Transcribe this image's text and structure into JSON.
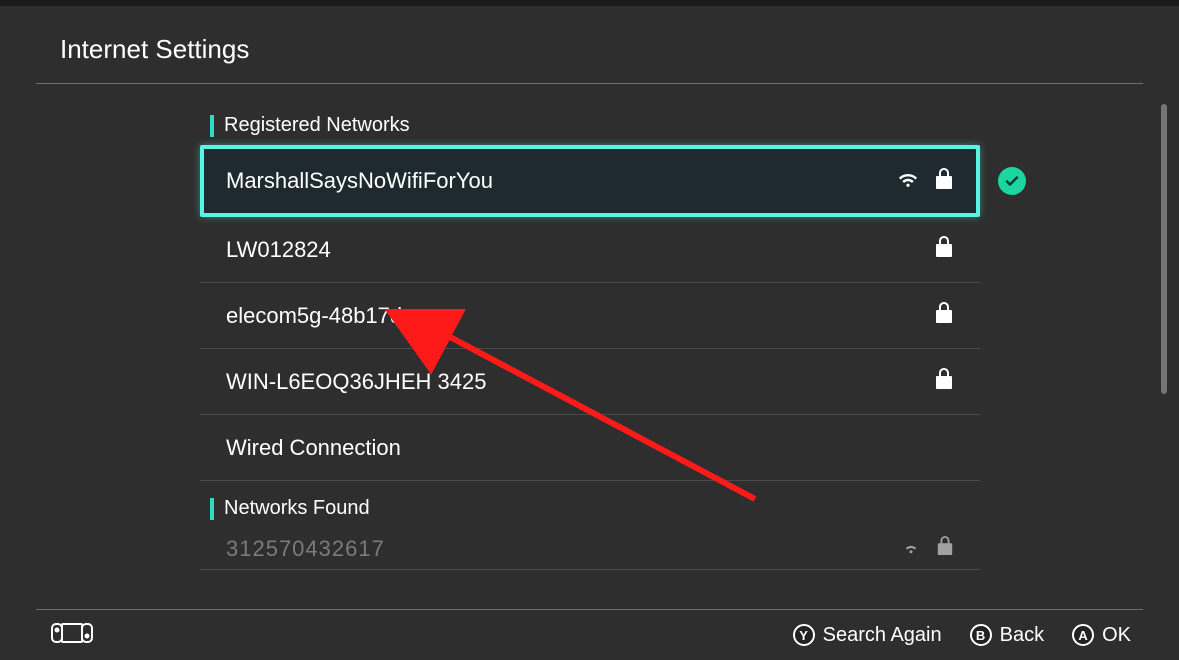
{
  "header": {
    "title": "Internet Settings"
  },
  "sections": {
    "registered": {
      "title": "Registered Networks",
      "items": [
        {
          "ssid": "MarshallSaysNoWifiForYou",
          "wifi": true,
          "locked": true,
          "selected": true,
          "connected": true
        },
        {
          "ssid": "LW012824",
          "wifi": false,
          "locked": true,
          "selected": false,
          "connected": false
        },
        {
          "ssid": "elecom5g-48b17d",
          "wifi": false,
          "locked": true,
          "selected": false,
          "connected": false
        },
        {
          "ssid": "WIN-L6EOQ36JHEH 3425",
          "wifi": false,
          "locked": true,
          "selected": false,
          "connected": false
        },
        {
          "ssid": "Wired Connection",
          "wifi": false,
          "locked": false,
          "selected": false,
          "connected": false
        }
      ]
    },
    "found": {
      "title": "Networks Found",
      "items": [
        {
          "ssid": "312570432617",
          "wifi": true,
          "locked": true
        }
      ]
    }
  },
  "footer": {
    "hints": [
      {
        "button": "Y",
        "label": "Search Again"
      },
      {
        "button": "B",
        "label": "Back"
      },
      {
        "button": "A",
        "label": "OK"
      }
    ]
  },
  "colors": {
    "accent": "#59f4e6",
    "check": "#1bd6a0"
  }
}
